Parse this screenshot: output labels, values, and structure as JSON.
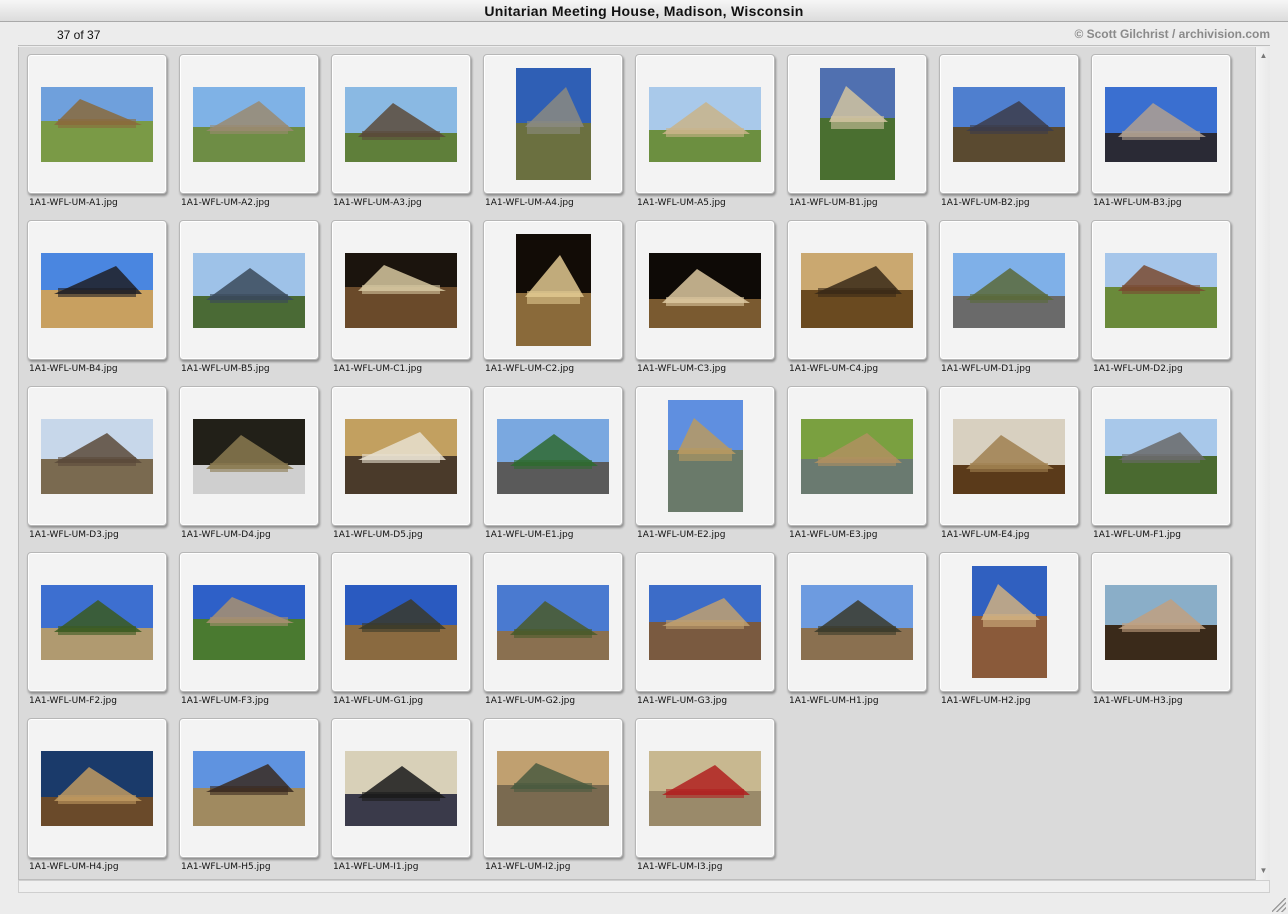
{
  "window": {
    "title": "Unitarian Meeting House, Madison, Wisconsin"
  },
  "status": {
    "count": "37 of 37",
    "credit": "© Scott Gilchrist / archivision.com"
  },
  "icons": {
    "scroll_up": "scroll-up-arrow-icon",
    "scroll_down": "scroll-down-arrow-icon",
    "resize": "resize-grip-icon"
  },
  "colors": {
    "window_bg": "#ececec",
    "browser_bg": "#dadada",
    "slide_mount": "#f3f3f3"
  },
  "slides": [
    {
      "file": "1A1-WFL-UM-A1.jpg",
      "orientation": "landscape",
      "scene": "meeting house exterior across lawn with bare trees"
    },
    {
      "file": "1A1-WFL-UM-A2.jpg",
      "orientation": "landscape",
      "scene": "copper roof prow, side view"
    },
    {
      "file": "1A1-WFL-UM-A3.jpg",
      "orientation": "landscape",
      "scene": "triangular glass prow front"
    },
    {
      "file": "1A1-WFL-UM-A4.jpg",
      "orientation": "portrait",
      "scene": "roof prow against blue sky"
    },
    {
      "file": "1A1-WFL-UM-A5.jpg",
      "orientation": "landscape",
      "scene": "triangular prow front elevation"
    },
    {
      "file": "1A1-WFL-UM-B1.jpg",
      "orientation": "portrait",
      "scene": "prow glazing over stone base"
    },
    {
      "file": "1A1-WFL-UM-B2.jpg",
      "orientation": "landscape",
      "scene": "prow window detail"
    },
    {
      "file": "1A1-WFL-UM-B3.jpg",
      "orientation": "landscape",
      "scene": "prow underside against sky"
    },
    {
      "file": "1A1-WFL-UM-B4.jpg",
      "orientation": "landscape",
      "scene": "prow underside detail"
    },
    {
      "file": "1A1-WFL-UM-B5.jpg",
      "orientation": "landscape",
      "scene": "roof side with trees"
    },
    {
      "file": "1A1-WFL-UM-C1.jpg",
      "orientation": "landscape",
      "scene": "auditorium interior toward prow"
    },
    {
      "file": "1A1-WFL-UM-C2.jpg",
      "orientation": "portrait",
      "scene": "interior balcony with lights"
    },
    {
      "file": "1A1-WFL-UM-C3.jpg",
      "orientation": "landscape",
      "scene": "interior balcony and ceiling lights"
    },
    {
      "file": "1A1-WFL-UM-C4.jpg",
      "orientation": "landscape",
      "scene": "auditorium seating and stone wall"
    },
    {
      "file": "1A1-WFL-UM-D1.jpg",
      "orientation": "landscape",
      "scene": "low wing across parking lot"
    },
    {
      "file": "1A1-WFL-UM-D2.jpg",
      "orientation": "landscape",
      "scene": "low wing with lawn"
    },
    {
      "file": "1A1-WFL-UM-D3.jpg",
      "orientation": "landscape",
      "scene": "entry canopy from street"
    },
    {
      "file": "1A1-WFL-UM-D4.jpg",
      "orientation": "landscape",
      "scene": "entry steps under canopy"
    },
    {
      "file": "1A1-WFL-UM-D5.jpg",
      "orientation": "landscape",
      "scene": "interior hall with stone wall"
    },
    {
      "file": "1A1-WFL-UM-E1.jpg",
      "orientation": "landscape",
      "scene": "long low roofline and shadow"
    },
    {
      "file": "1A1-WFL-UM-E2.jpg",
      "orientation": "portrait",
      "scene": "roofline over stone wall"
    },
    {
      "file": "1A1-WFL-UM-E3.jpg",
      "orientation": "landscape",
      "scene": "stone wall beneath copper fascia"
    },
    {
      "file": "1A1-WFL-UM-E4.jpg",
      "orientation": "landscape",
      "scene": "clerestory windows along wall"
    },
    {
      "file": "1A1-WFL-UM-F1.jpg",
      "orientation": "landscape",
      "scene": "low wing and chimney"
    },
    {
      "file": "1A1-WFL-UM-F2.jpg",
      "orientation": "landscape",
      "scene": "stone chimney mass"
    },
    {
      "file": "1A1-WFL-UM-F3.jpg",
      "orientation": "landscape",
      "scene": "cantilevered roof over lawn"
    },
    {
      "file": "1A1-WFL-UM-G1.jpg",
      "orientation": "landscape",
      "scene": "terrace with stone walls"
    },
    {
      "file": "1A1-WFL-UM-G2.jpg",
      "orientation": "landscape",
      "scene": "stone pier and roof edge"
    },
    {
      "file": "1A1-WFL-UM-G3.jpg",
      "orientation": "landscape",
      "scene": "long wing with windows"
    },
    {
      "file": "1A1-WFL-UM-H1.jpg",
      "orientation": "landscape",
      "scene": "wing with stone and trees"
    },
    {
      "file": "1A1-WFL-UM-H2.jpg",
      "orientation": "portrait",
      "scene": "roof overhang and terrace"
    },
    {
      "file": "1A1-WFL-UM-H3.jpg",
      "orientation": "landscape",
      "scene": "glazed corridor exterior"
    },
    {
      "file": "1A1-WFL-UM-H4.jpg",
      "orientation": "landscape",
      "scene": "skylit corridor and garden"
    },
    {
      "file": "1A1-WFL-UM-H5.jpg",
      "orientation": "landscape",
      "scene": "low building across open ground"
    },
    {
      "file": "1A1-WFL-UM-I1.jpg",
      "orientation": "landscape",
      "scene": "window seat with cushions"
    },
    {
      "file": "1A1-WFL-UM-I2.jpg",
      "orientation": "landscape",
      "scene": "stone wall meets glass"
    },
    {
      "file": "1A1-WFL-UM-I3.jpg",
      "orientation": "landscape",
      "scene": "red signature tile in stone wall"
    }
  ]
}
